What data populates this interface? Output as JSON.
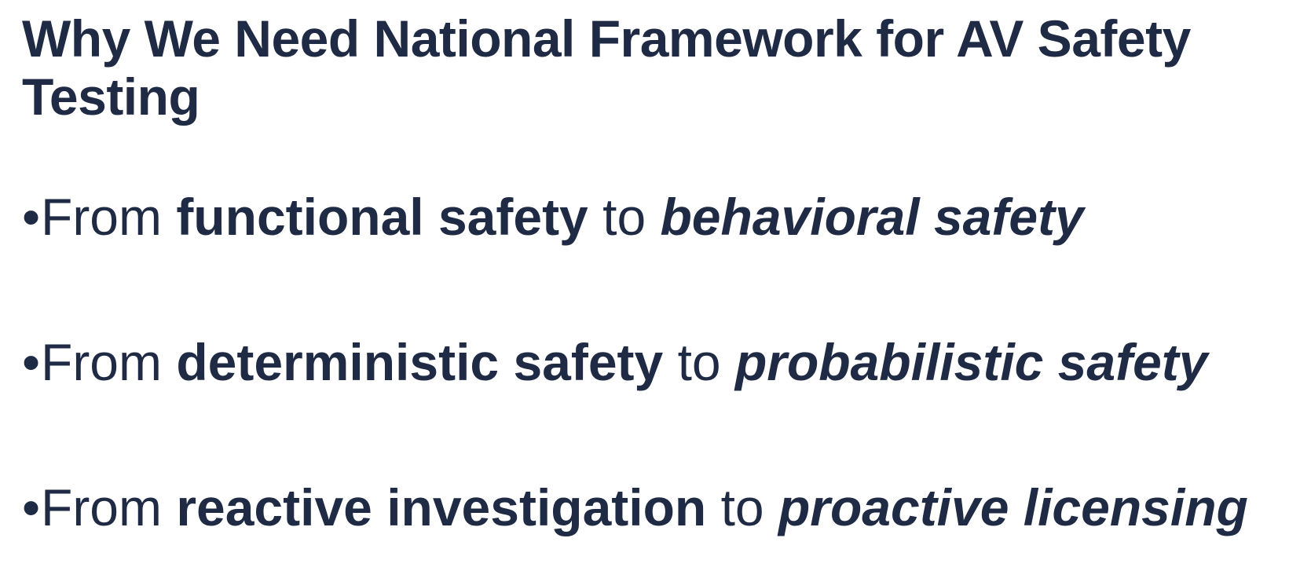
{
  "slide": {
    "title": "Why We Need National Framework for AV Safety Testing",
    "bullets": [
      {
        "marker": "•",
        "lead": "From ",
        "strong": "functional safety",
        "mid": " to ",
        "emph": "behavioral safety"
      },
      {
        "marker": "•",
        "lead": "From ",
        "strong": "deterministic safety",
        "mid": " to ",
        "emph": "probabilistic safety"
      },
      {
        "marker": "•",
        "lead": "From ",
        "strong": "reactive investigation",
        "mid": " to ",
        "emph": "proactive licensing"
      }
    ]
  },
  "colors": {
    "text": "#1f2a44",
    "background": "#ffffff"
  }
}
